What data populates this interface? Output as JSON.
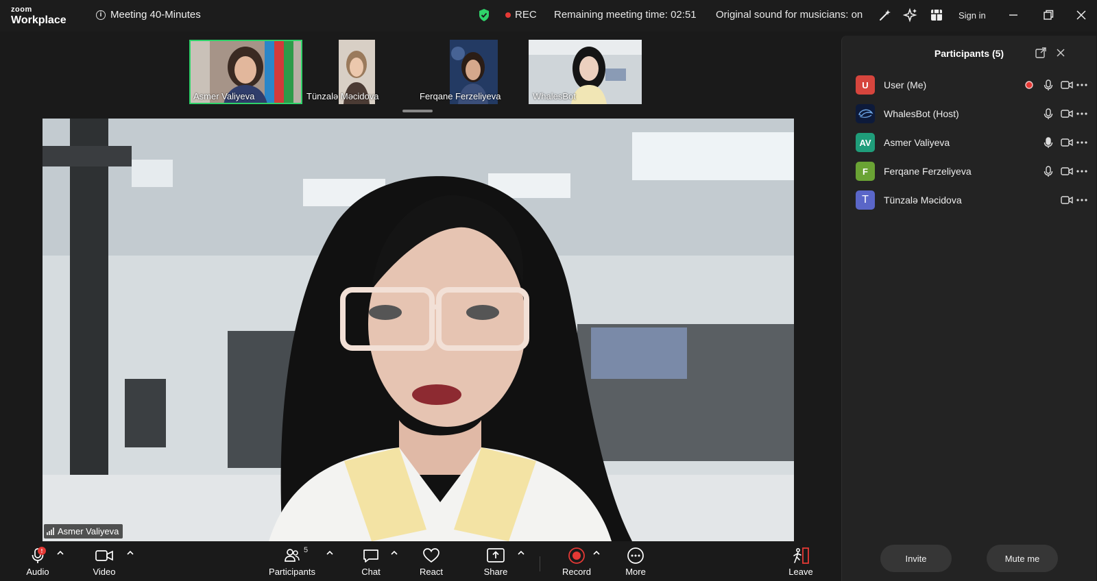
{
  "brand": {
    "line1": "zoom",
    "line2": "Workplace"
  },
  "meeting": {
    "title": "Meeting 40-Minutes"
  },
  "status": {
    "rec_label": "REC",
    "remaining_label": "Remaining meeting time:",
    "remaining_time": "02:51",
    "original_sound": "Original sound for musicians: on"
  },
  "header": {
    "signin": "Sign in"
  },
  "colors": {
    "accent_green": "#2fd36a",
    "rec_red": "#e53935",
    "avatar_u": "#d6453d",
    "avatar_av": "#1f9d7a",
    "avatar_f": "#6aa334",
    "avatar_t": "#5a66c8"
  },
  "thumbnails": [
    {
      "name": "Asmer Valiyeva",
      "active": true
    },
    {
      "name": "Tünzalə Məcidova",
      "active": false
    },
    {
      "name": "Ferqane Ferzeliyeva",
      "active": false
    },
    {
      "name": "WhalesBot",
      "active": false
    }
  ],
  "main_video": {
    "name": "Asmer Valiyeva"
  },
  "panel": {
    "title": "Participants (5)",
    "participants": [
      {
        "initials": "U",
        "name": "User (Me)",
        "mic": true,
        "recording": true,
        "video": true
      },
      {
        "initials": "",
        "name": "WhalesBot (Host)",
        "mic": true,
        "recording": false,
        "video": true
      },
      {
        "initials": "AV",
        "name": "Asmer Valiyeva",
        "mic": true,
        "recording": false,
        "video": true
      },
      {
        "initials": "F",
        "name": "Ferqane Ferzeliyeva",
        "mic": true,
        "recording": false,
        "video": true
      },
      {
        "initials": "T",
        "name": "Tünzalə Məcidova",
        "mic": false,
        "recording": false,
        "video": true
      }
    ],
    "invite": "Invite",
    "mute_me": "Mute me"
  },
  "toolbar": {
    "audio": "Audio",
    "audio_badge": "!",
    "video": "Video",
    "participants": "Participants",
    "participants_count": "5",
    "chat": "Chat",
    "react": "React",
    "share": "Share",
    "record": "Record",
    "more": "More",
    "leave": "Leave"
  }
}
